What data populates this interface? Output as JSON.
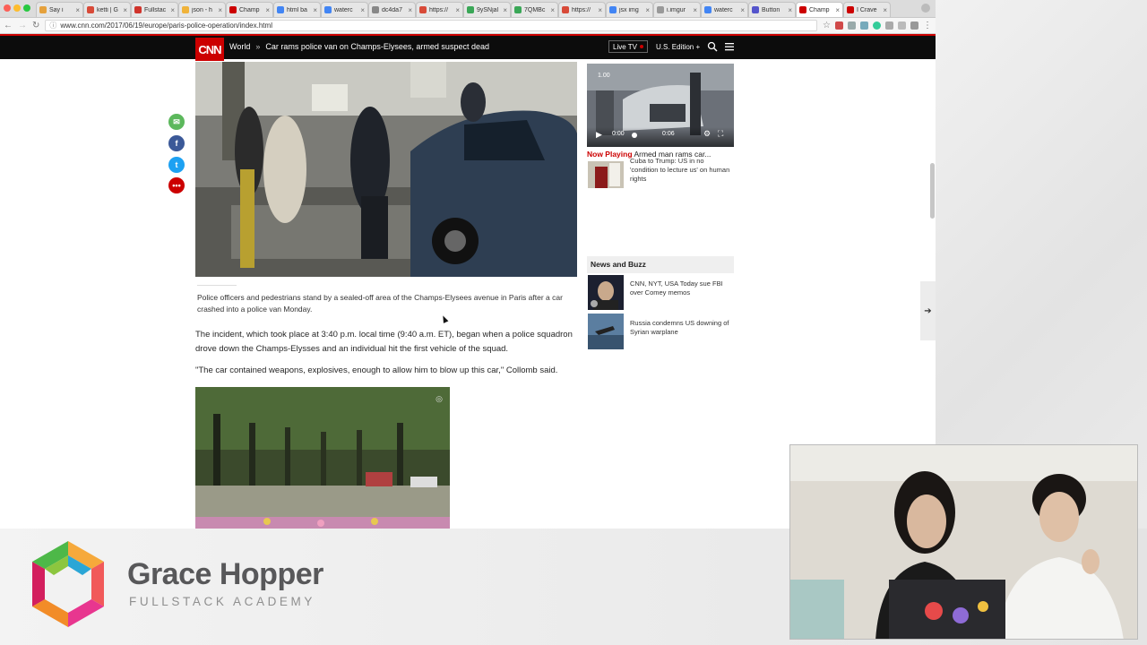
{
  "browser": {
    "tabs": [
      {
        "label": "Say i",
        "color": "#e5a13c"
      },
      {
        "label": "ketti | G",
        "color": "#d84a38"
      },
      {
        "label": "Fullstac",
        "color": "#d0342c"
      },
      {
        "label": "json - h",
        "color": "#f0b33a"
      },
      {
        "label": "Champ",
        "color": "#cc0000"
      },
      {
        "label": "html ba",
        "color": "#4285f4"
      },
      {
        "label": "waterc",
        "color": "#4285f4"
      },
      {
        "label": "dc4da7",
        "color": "#888888"
      },
      {
        "label": "https://",
        "color": "#d84a38"
      },
      {
        "label": "9ySNjal",
        "color": "#3aa757"
      },
      {
        "label": "7QMBc",
        "color": "#3aa757"
      },
      {
        "label": "https://",
        "color": "#d84a38"
      },
      {
        "label": "jsx img",
        "color": "#4285f4"
      },
      {
        "label": "i.imgur",
        "color": "#999999"
      },
      {
        "label": "waterc",
        "color": "#4285f4"
      },
      {
        "label": "Button",
        "color": "#5555cc"
      },
      {
        "label": "Champ",
        "color": "#cc0000",
        "active": true
      },
      {
        "label": "I Crave",
        "color": "#cc0000"
      }
    ],
    "url": "www.cnn.com/2017/06/19/europe/paris-police-operation/index.html"
  },
  "header": {
    "logo": "CNN",
    "section": "World",
    "separator": "»",
    "headline": "Car rams police van on Champs-Elysees, armed suspect dead",
    "live_tv": "Live TV",
    "edition": "U.S. Edition +"
  },
  "article": {
    "caption": "Police officers and pedestrians stand by a sealed-off area of the Champs-Elysees avenue in Paris after a car crashed into a police van Monday.",
    "para1": "The incident, which took place at 3:40 p.m. local time (9:40 a.m. ET), began when a police squadron drove down the Champs-Elysses and an individual hit the first vehicle of the squad.",
    "para2": "\"The car contained weapons, explosives, enough to allow him to blow up this car,\" Collomb said."
  },
  "sidebar": {
    "video": {
      "badge": "1.00",
      "time_current": "0:00",
      "time_total": "0:06"
    },
    "now_playing_label": "Now Playing",
    "now_playing_title": "Armed man rams car...",
    "related_title": "Cuba to Trump: US in no 'condition to lecture us' on human rights",
    "buzz_header": "News and Buzz",
    "buzz_items": [
      {
        "title": "CNN, NYT, USA Today sue FBI over Comey memos"
      },
      {
        "title": "Russia condemns US downing of Syrian warplane"
      }
    ]
  },
  "branding": {
    "title": "Grace Hopper",
    "subtitle": "FULLSTACK ACADEMY"
  },
  "colors": {
    "cnn_red": "#cc0000",
    "email": "#5cb85c",
    "facebook": "#3b5998",
    "twitter": "#1da1f2",
    "more": "#cc0000"
  }
}
